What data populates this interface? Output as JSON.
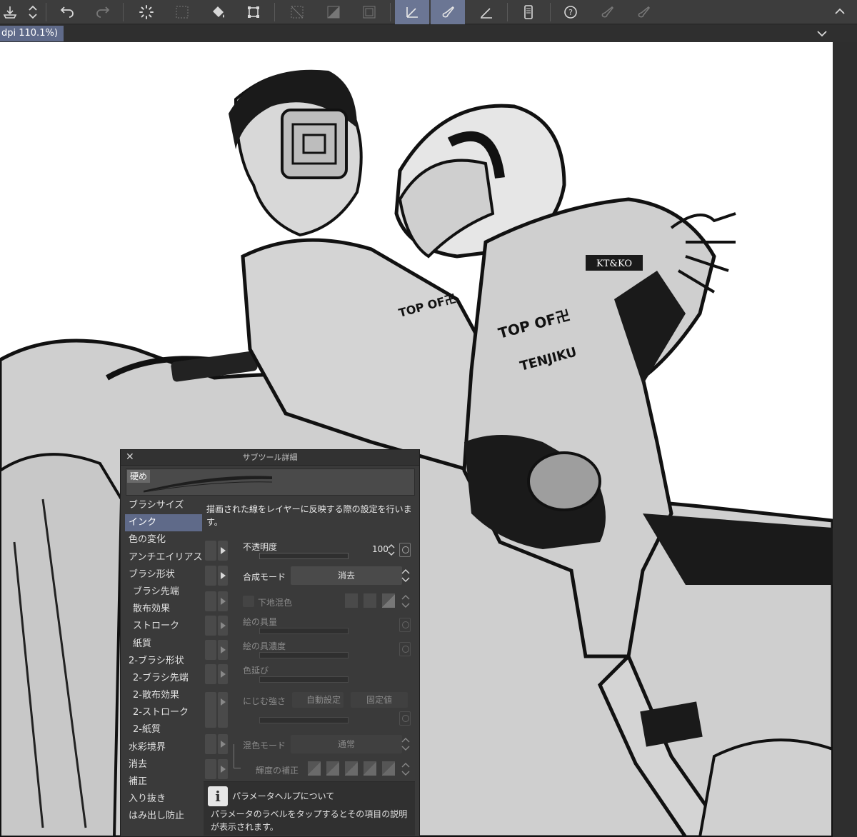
{
  "tab": {
    "title": "dpi 110.1%)"
  },
  "panel": {
    "title": "サブツール詳細",
    "preset_name": "硬め",
    "categories": [
      {
        "label": "ブラシサイズ",
        "sub": false,
        "selected": false
      },
      {
        "label": "インク",
        "sub": false,
        "selected": true
      },
      {
        "label": "色の変化",
        "sub": false,
        "selected": false
      },
      {
        "label": "アンチエイリアス",
        "sub": false,
        "selected": false
      },
      {
        "label": "ブラシ形状",
        "sub": false,
        "selected": false
      },
      {
        "label": "ブラシ先端",
        "sub": true,
        "selected": false
      },
      {
        "label": "散布効果",
        "sub": true,
        "selected": false
      },
      {
        "label": "ストローク",
        "sub": true,
        "selected": false
      },
      {
        "label": "紙質",
        "sub": true,
        "selected": false
      },
      {
        "label": "2-ブラシ形状",
        "sub": false,
        "selected": false
      },
      {
        "label": "2-ブラシ先端",
        "sub": true,
        "selected": false
      },
      {
        "label": "2-散布効果",
        "sub": true,
        "selected": false
      },
      {
        "label": "2-ストローク",
        "sub": true,
        "selected": false
      },
      {
        "label": "2-紙質",
        "sub": true,
        "selected": false
      },
      {
        "label": "水彩境界",
        "sub": false,
        "selected": false
      },
      {
        "label": "消去",
        "sub": false,
        "selected": false
      },
      {
        "label": "補正",
        "sub": false,
        "selected": false
      },
      {
        "label": "入り抜き",
        "sub": false,
        "selected": false
      },
      {
        "label": "はみ出し防止",
        "sub": false,
        "selected": false
      }
    ],
    "description": "描画された線をレイヤーに反映する際の設定を行います。",
    "opacity": {
      "label": "不透明度",
      "value": "100"
    },
    "blend_mode": {
      "label": "合成モード",
      "value": "消去"
    },
    "underlay_mix": {
      "label": "下地混色"
    },
    "paint_amount": {
      "label": "絵の具量"
    },
    "paint_density": {
      "label": "絵の具濃度"
    },
    "color_stretch": {
      "label": "色延び"
    },
    "blur_strength": {
      "label": "にじむ強さ",
      "auto": "自動設定",
      "fixed": "固定値"
    },
    "mix_mode": {
      "label": "混色モード",
      "value": "通常"
    },
    "brightness_correction": {
      "label": "輝度の補正"
    },
    "help": {
      "title": "パラメータヘルプについて",
      "body": "パラメータのラベルをタップするとその項目の説明が表示されます。"
    }
  },
  "colors": {
    "accent": "#5f6a89",
    "toolbar_bg": "#3d3d3d",
    "panel_bg": "#3a3a3a"
  }
}
